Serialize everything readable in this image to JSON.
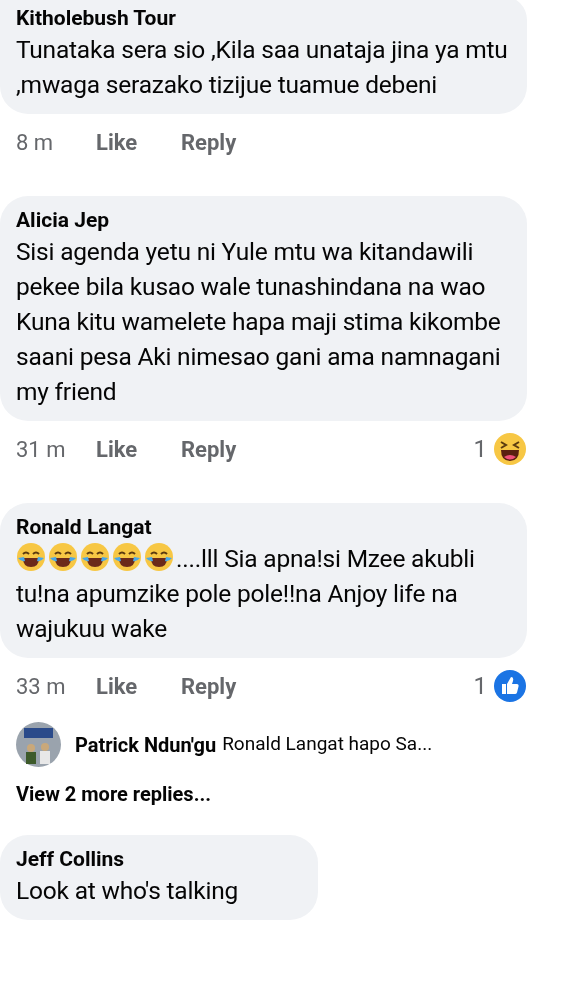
{
  "comments": [
    {
      "author": "Kitholebush Tour",
      "text": "Tunataka sera sio ,Kila saa unataja jina ya mtu ,mwaga serazako tizijue tuamue debeni",
      "time": "8 m",
      "like": "Like",
      "reply": "Reply"
    },
    {
      "author": "Alicia Jep",
      "text": "Sisi agenda yetu ni Yule mtu wa kitandawili pekee bila kusao wale tunashindana na wao Kuna kitu wamelete hapa maji stima kikombe saani pesa Aki nimesao gani ama namnagani my friend",
      "time": "31 m",
      "like": "Like",
      "reply": "Reply",
      "reaction": {
        "count": "1",
        "kind": "haha"
      }
    },
    {
      "author": "Ronald Langat",
      "leading_emoji": [
        {
          "kind": "laugh-cry"
        },
        {
          "kind": "laugh-cry"
        },
        {
          "kind": "laugh-cry"
        },
        {
          "kind": "laugh-cry"
        },
        {
          "kind": "laugh-cry"
        }
      ],
      "text": "....lll Sia apna!si Mzee akubli tu!na apumzike pole pole!!na Anjoy life na wajukuu wake",
      "time": "33 m",
      "like": "Like",
      "reply": "Reply",
      "reaction": {
        "count": "1",
        "kind": "like"
      },
      "reply_preview": {
        "author": "Patrick Ndun'gu",
        "text": "Ronald Langat hapo Sa..."
      },
      "more_replies": "View 2 more replies..."
    },
    {
      "author": "Jeff Collins",
      "text": "Look at who's talking"
    }
  ]
}
